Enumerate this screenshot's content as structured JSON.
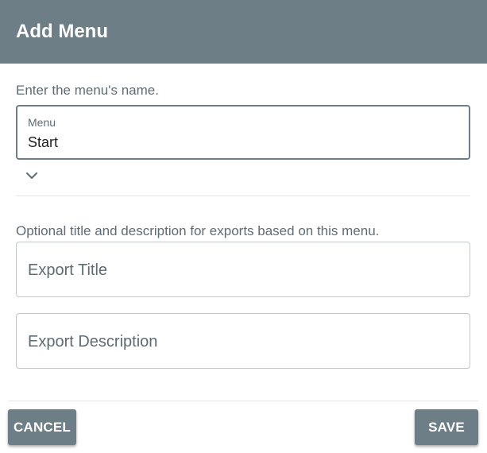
{
  "dialog": {
    "title": "Add Menu",
    "menu_hint": "Enter the menu's name.",
    "menu_field": {
      "label": "Menu",
      "value": "Start"
    },
    "export_hint": "Optional title and description for exports based on this menu.",
    "export_title": {
      "placeholder": "Export Title",
      "value": ""
    },
    "export_description": {
      "placeholder": "Export Description",
      "value": ""
    },
    "buttons": {
      "cancel": "CANCEL",
      "save": "SAVE"
    }
  },
  "icons": {
    "expand": "chevron-down-icon"
  },
  "colors": {
    "header": "#6e7e87",
    "button": "#6e7e87",
    "hint_text": "#5f6b72"
  }
}
